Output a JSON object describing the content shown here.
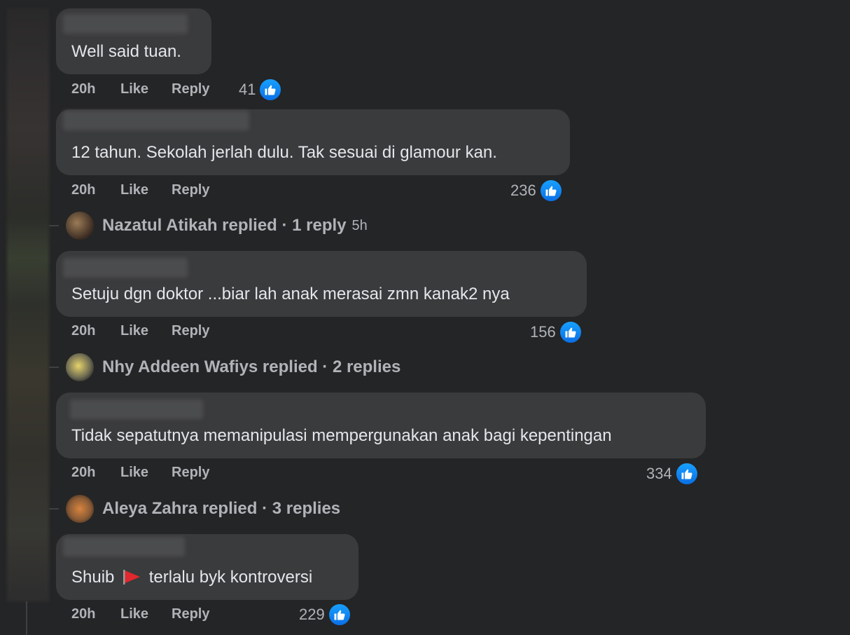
{
  "comments": [
    {
      "text": "Well said tuan.",
      "time": "20h",
      "like": "Like",
      "reply": "Reply",
      "reactions": "41"
    },
    {
      "text": "12 tahun. Sekolah jerlah dulu. Tak sesuai di glamour kan.",
      "time": "20h",
      "like": "Like",
      "reply": "Reply",
      "reactions": "236"
    },
    {
      "text": "Setuju dgn doktor ...biar lah anak merasai zmn kanak2 nya",
      "time": "20h",
      "like": "Like",
      "reply": "Reply",
      "reactions": "156"
    },
    {
      "text": "Tidak sepatutnya memanipulasi mempergunakan anak bagi kepentingan",
      "time": "20h",
      "like": "Like",
      "reply": "Reply",
      "reactions": "334"
    },
    {
      "text_before": "Shuib",
      "text_after": "terlalu byk kontroversi",
      "time": "20h",
      "like": "Like",
      "reply": "Reply",
      "reactions": "229"
    }
  ],
  "reply_threads": [
    {
      "label": "Nazatul Atikah replied · 1 reply",
      "time": "5h"
    },
    {
      "label": "Nhy Addeen Wafiys replied · 2 replies"
    },
    {
      "label": "Aleya Zahra replied · 3 replies"
    }
  ],
  "icons": {
    "reaction": "like-icon",
    "emoji": "red-flag-icon"
  },
  "colors": {
    "background": "#242526",
    "bubble": "#3a3b3c",
    "like_blue": "#1877f2",
    "muted_text": "#b0b3b8"
  }
}
